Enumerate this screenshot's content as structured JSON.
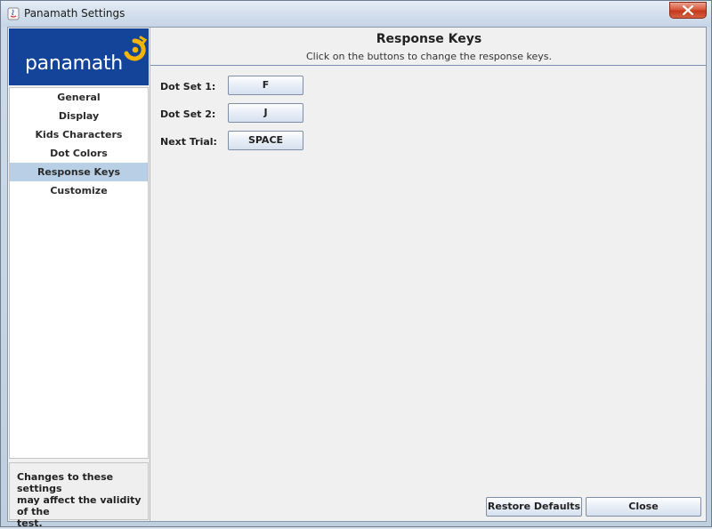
{
  "window": {
    "title": "Panamath Settings",
    "close_glyph": "✕"
  },
  "logo": {
    "text": "panamath",
    "icon": "panamath-logo-mark"
  },
  "sidebar": {
    "items": [
      {
        "label": "General"
      },
      {
        "label": "Display"
      },
      {
        "label": "Kids Characters"
      },
      {
        "label": "Dot Colors"
      },
      {
        "label": "Response Keys",
        "active": true
      },
      {
        "label": "Customize"
      }
    ],
    "warning": "Changes to these settings\nmay affect the validity of the\ntest."
  },
  "header": {
    "title": "Response Keys",
    "subtitle": "Click on the buttons to change the response keys."
  },
  "fields": [
    {
      "label": "Dot Set 1:",
      "value": "F"
    },
    {
      "label": "Dot Set 2:",
      "value": "J"
    },
    {
      "label": "Next Trial:",
      "value": "SPACE"
    }
  ],
  "footer": {
    "restore_label": "Restore Defaults",
    "close_label": "Close"
  },
  "colors": {
    "logo_bg": "#14449a",
    "logo_accent": "#f5b400",
    "active_item": "#b8cfe5"
  }
}
